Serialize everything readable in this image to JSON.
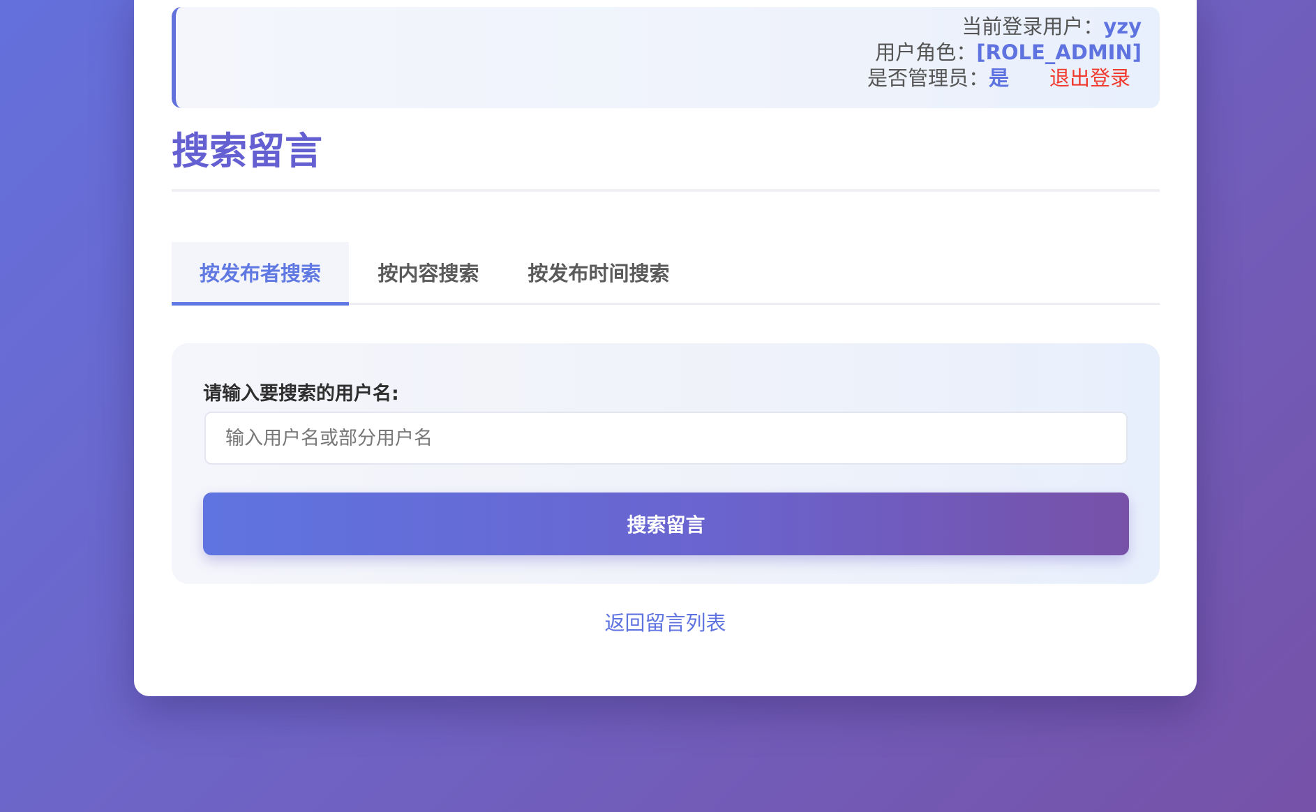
{
  "user_info": {
    "current_user_label": "当前登录用户：",
    "current_user_value": "yzy",
    "role_label": "用户角色：",
    "role_value": "[ROLE_ADMIN]",
    "is_admin_label": "是否管理员：",
    "is_admin_value": "是",
    "logout_label": "退出登录"
  },
  "page": {
    "title": "搜索留言"
  },
  "tabs": [
    {
      "label": "按发布者搜索",
      "active": true
    },
    {
      "label": "按内容搜索",
      "active": false
    },
    {
      "label": "按发布时间搜索",
      "active": false
    }
  ],
  "search": {
    "label": "请输入要搜索的用户名:",
    "value": "",
    "placeholder": "输入用户名或部分用户名",
    "button_label": "搜索留言"
  },
  "footer": {
    "back_link": "返回留言列表"
  },
  "colors": {
    "accent": "#5f73e0",
    "title": "#6560d2",
    "logout": "#f03a2e"
  }
}
